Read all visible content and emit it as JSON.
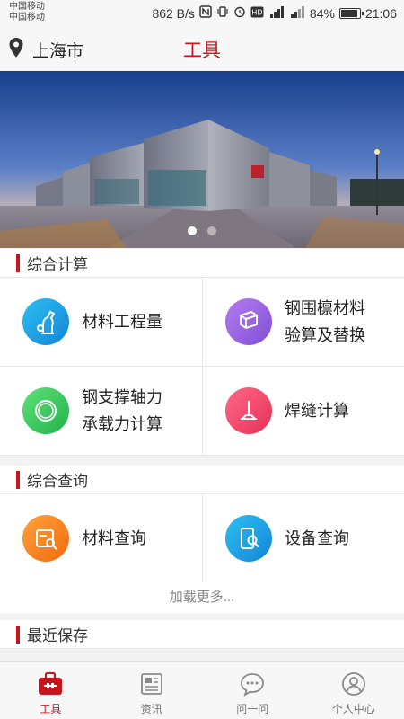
{
  "status_bar": {
    "carrier_1": "中国移动",
    "carrier_2": "中国移动",
    "network_speed": "862 B/s",
    "battery": "84%",
    "time": "21:06"
  },
  "header": {
    "location": "上海市",
    "title": "工具"
  },
  "banner": {
    "slide_count": 2,
    "active_slide": 1
  },
  "sections": {
    "calc": {
      "title": "综合计算",
      "items": [
        {
          "line1": "材料工程量",
          "line2": ""
        },
        {
          "line1": "钢围檩材料",
          "line2": "验算及替换"
        },
        {
          "line1": "钢支撑轴力",
          "line2": "承载力计算"
        },
        {
          "line1": "焊缝计算",
          "line2": ""
        }
      ]
    },
    "query": {
      "title": "综合查询",
      "items": [
        {
          "line1": "材料查询",
          "line2": ""
        },
        {
          "line1": "设备查询",
          "line2": ""
        }
      ],
      "load_more": "加载更多..."
    },
    "recent": {
      "title": "最近保存"
    }
  },
  "tabbar": {
    "tabs": [
      {
        "label": "工具",
        "icon": "toolbox-icon",
        "active": true
      },
      {
        "label": "资讯",
        "icon": "news-icon",
        "active": false
      },
      {
        "label": "问一问",
        "icon": "chat-icon",
        "active": false
      },
      {
        "label": "个人中心",
        "icon": "user-icon",
        "active": false
      }
    ]
  },
  "colors": {
    "accent": "#c4161c",
    "icon_blue": "#1aa8e8",
    "icon_purple": "#9b5ee0",
    "icon_green": "#3cc85a",
    "icon_pink": "#f0456e",
    "icon_orange": "#f7871e"
  }
}
